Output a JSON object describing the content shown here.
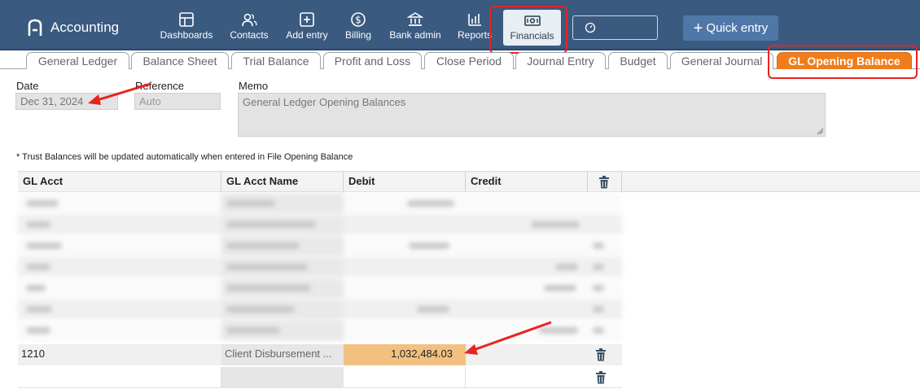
{
  "brand": {
    "name": "Accounting"
  },
  "nav": {
    "dashboards": "Dashboards",
    "contacts": "Contacts",
    "add_entry": "Add entry",
    "billing": "Billing",
    "bank_admin": "Bank admin",
    "reports": "Reports",
    "financials": "Financials",
    "quick_entry": "Quick entry"
  },
  "tabs": [
    "General Ledger",
    "Balance Sheet",
    "Trial Balance",
    "Profit and Loss",
    "Close Period",
    "Journal Entry",
    "Budget",
    "General Journal",
    "GL Opening Balance"
  ],
  "form": {
    "date_label": "Date",
    "date_value": "Dec 31, 2024",
    "reference_label": "Reference",
    "reference_value": "Auto",
    "memo_label": "Memo",
    "memo_value": "General Ledger Opening Balances"
  },
  "note": "* Trust Balances will be updated automatically when entered in File Opening Balance",
  "grid": {
    "columns": [
      "GL Acct",
      "GL Acct Name",
      "Debit",
      "Credit"
    ],
    "rows": [
      {
        "acct": "1210",
        "name": "Client Disbursement ...",
        "debit": "1,032,484.03",
        "credit": ""
      },
      {
        "acct": "",
        "name": "",
        "debit": "",
        "credit": ""
      }
    ]
  },
  "colors": {
    "nav_bg": "#3a5a80",
    "active_tab": "#f07d1a",
    "highlight": "#f2c181",
    "annotation": "#e8231f"
  }
}
